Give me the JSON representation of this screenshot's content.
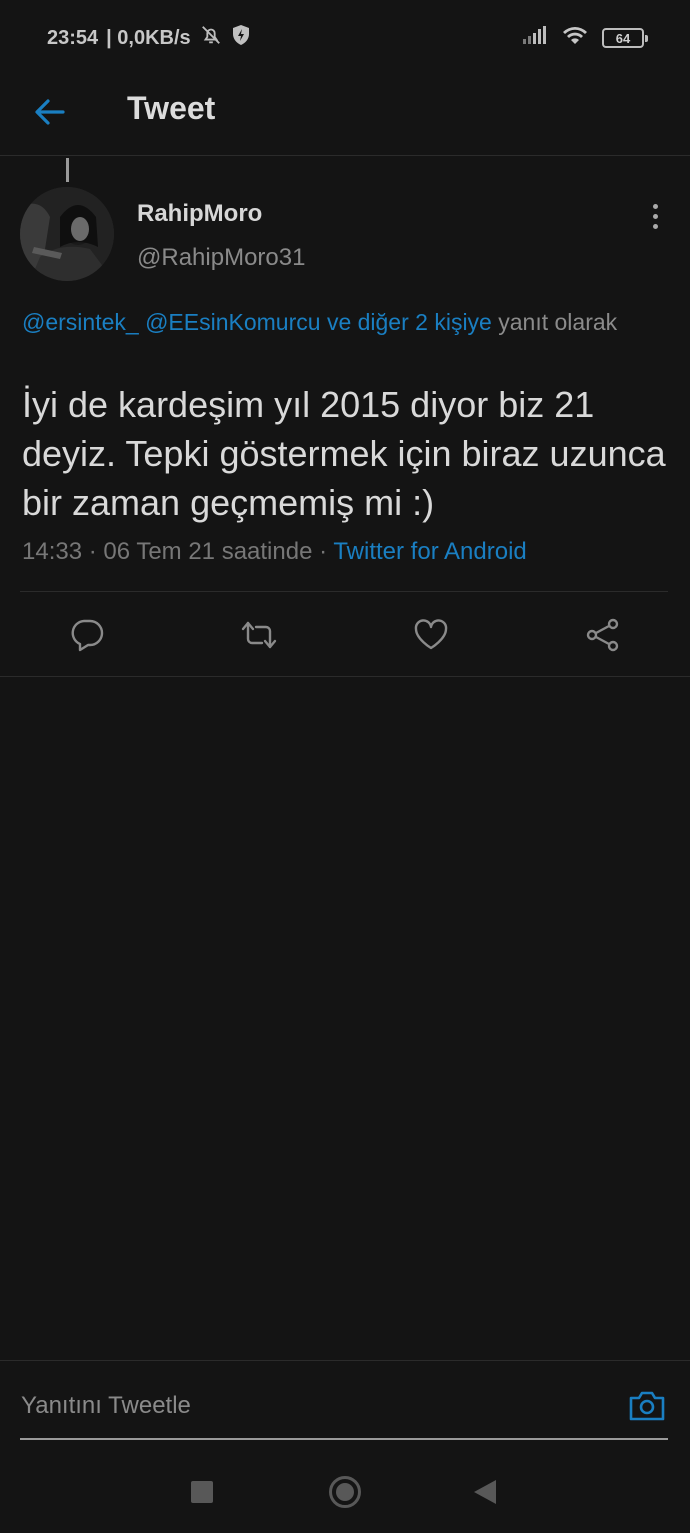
{
  "status_bar": {
    "time": "23:54",
    "speed": "| 0,0KB/s",
    "battery": "64"
  },
  "header": {
    "title": "Tweet"
  },
  "tweet": {
    "display_name": "RahipMoro",
    "handle": "@RahipMoro31",
    "reply_to": {
      "mention_1": "@ersintek_",
      "mention_2": "@EEsinKomurcu",
      "others": "ve diğer 2 kişiye",
      "suffix": "yanıt olarak"
    },
    "text": "İyi de kardeşim yıl 2015 diyor biz 21 deyiz. Tepki göstermek için biraz uzunca bir zaman geçmemiş mi :)",
    "meta": {
      "time_date": "14:33 · 06 Tem 21 saatinde ·",
      "source": "Twitter for Android"
    }
  },
  "composer": {
    "placeholder": "Yanıtını Tweetle"
  },
  "colors": {
    "background": "#141414",
    "accent": "#1a7fc2",
    "text": "#d9d9d9",
    "muted": "#8a8a8a"
  },
  "icons": {
    "back": "arrow-left-icon",
    "more": "more-vertical-icon",
    "reply": "reply-bubble-icon",
    "retweet": "retweet-icon",
    "like": "heart-icon",
    "share": "share-icon",
    "camera": "camera-icon"
  }
}
